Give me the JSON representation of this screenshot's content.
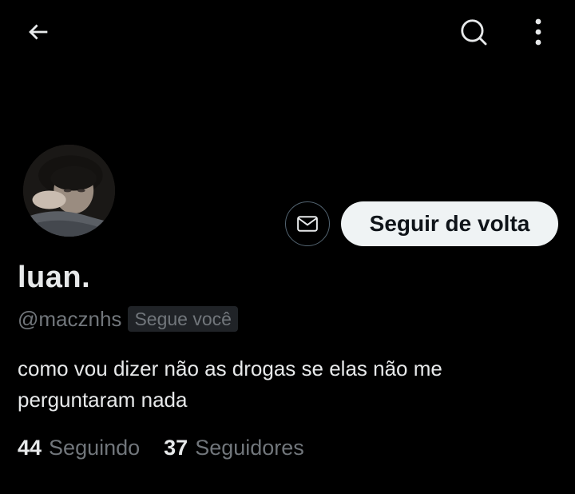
{
  "header": {
    "back_icon": "arrow-left-icon",
    "search_icon": "search-icon",
    "more_icon": "more-vertical-icon"
  },
  "profile": {
    "display_name": "luan.",
    "handle": "@macznhs",
    "follows_you": "Segue você",
    "bio": "como vou dizer não as drogas se elas não me perguntaram nada",
    "avatar_icon": "profile-photo"
  },
  "actions": {
    "message_icon": "envelope-icon",
    "follow_back_label": "Seguir de volta"
  },
  "stats": {
    "following_count": "44",
    "following_label": "Seguindo",
    "followers_count": "37",
    "followers_label": "Seguidores"
  },
  "colors": {
    "background": "#000000",
    "text_primary": "#e7e9ea",
    "text_secondary": "#71767b",
    "button_bg": "#eff3f4",
    "badge_bg": "#202327",
    "border": "#536471"
  }
}
